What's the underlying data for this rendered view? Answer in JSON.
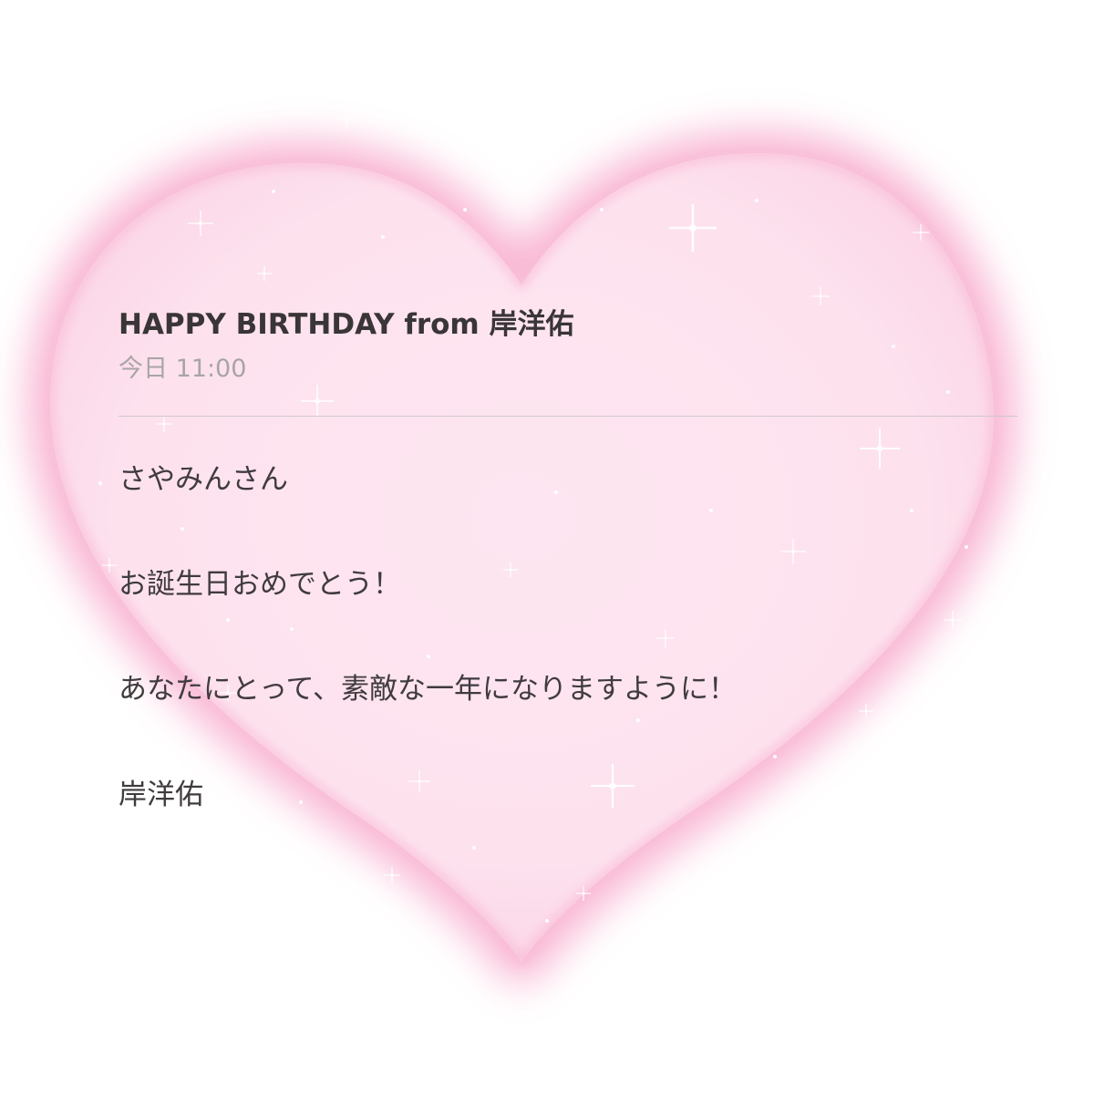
{
  "message": {
    "subject": "HAPPY BIRTHDAY from 岸洋佑",
    "timestamp": "今日 11:00",
    "body_lines": [
      "さやみんさん",
      "お誕生日おめでとう！",
      "あなたにとって、素敵な一年になりますように！",
      "岸洋佑"
    ]
  },
  "colors": {
    "heart_fill": "#fde3ef",
    "heart_glow": "#f8a6cb",
    "divider": "#cfc7cb",
    "subject_text": "#3a3537",
    "timestamp_text": "#a9a4a7"
  },
  "decoration": {
    "shape": "heart",
    "effect": "sparkles"
  }
}
